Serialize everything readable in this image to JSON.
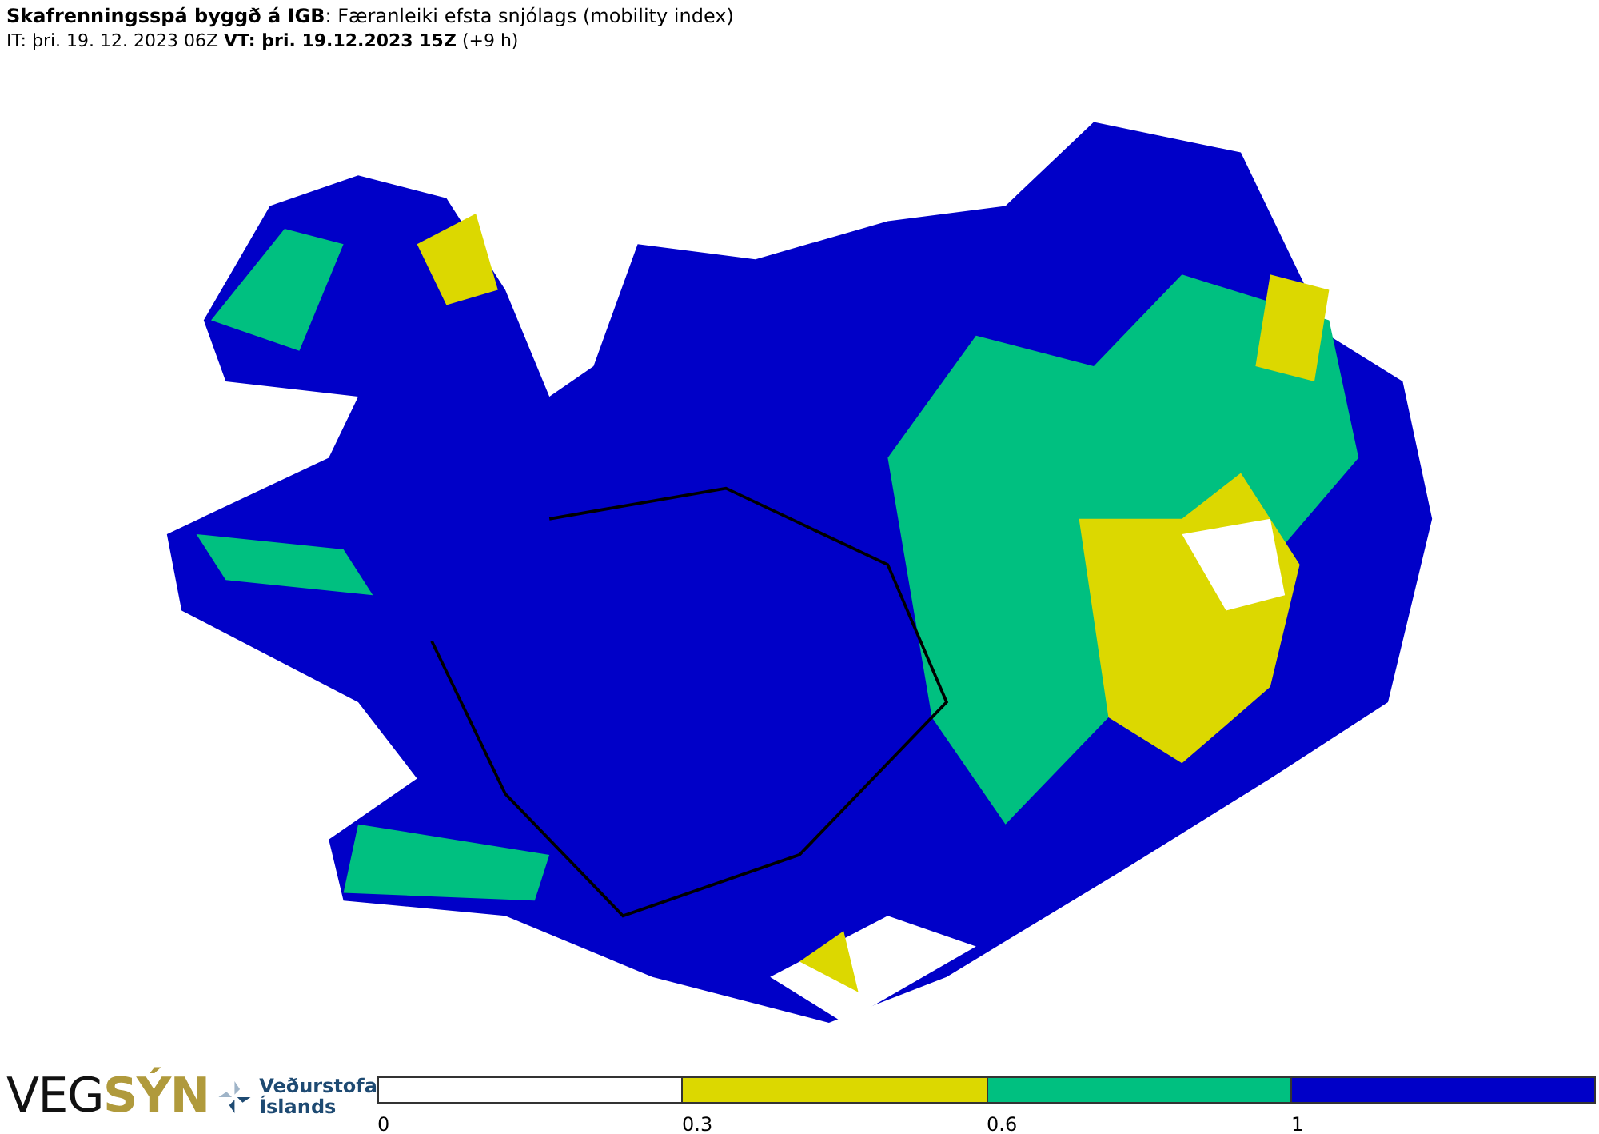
{
  "header": {
    "title": "**Skafrenningsspá byggð á IGB**: Færanleiki efsta snjólags (mobility index)",
    "times": "IT: þri. 19. 12. 2023 06Z **VT: þri. 19.12.2023 15Z** (+9 h)"
  },
  "logos": {
    "vegsyn": {
      "prefix": "VEG",
      "suffix": "SÝN"
    },
    "vedurstofa": [
      "Veðurstofa",
      "Íslands"
    ]
  },
  "legend": [
    {
      "label": "0",
      "color": "#ffffff"
    },
    {
      "label": "0.3",
      "color": "#dcd800"
    },
    {
      "label": "0.6",
      "color": "#00c080"
    },
    {
      "label": "1",
      "color": "#0000c8"
    }
  ]
}
